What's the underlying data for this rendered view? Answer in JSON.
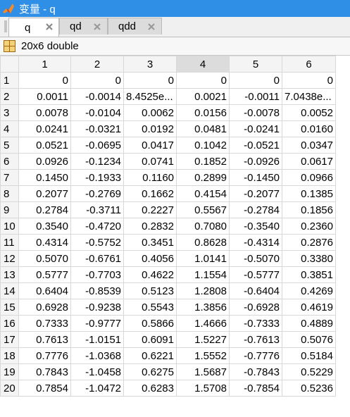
{
  "window": {
    "title": "变量 - q"
  },
  "tabs": [
    {
      "label": "q",
      "active": true
    },
    {
      "label": "qd",
      "active": false
    },
    {
      "label": "qdd",
      "active": false
    }
  ],
  "info": {
    "size_text": "20x6 double"
  },
  "table": {
    "columns": [
      "1",
      "2",
      "3",
      "4",
      "5",
      "6"
    ],
    "selected_column": "4",
    "rows": [
      {
        "label": "1",
        "cells": [
          "0",
          "0",
          "0",
          "0",
          "0",
          "0"
        ]
      },
      {
        "label": "2",
        "cells": [
          "0.0011",
          "-0.0014",
          "8.4525e...",
          "0.0021",
          "-0.0011",
          "7.0438e..."
        ]
      },
      {
        "label": "3",
        "cells": [
          "0.0078",
          "-0.0104",
          "0.0062",
          "0.0156",
          "-0.0078",
          "0.0052"
        ]
      },
      {
        "label": "4",
        "cells": [
          "0.0241",
          "-0.0321",
          "0.0192",
          "0.0481",
          "-0.0241",
          "0.0160"
        ]
      },
      {
        "label": "5",
        "cells": [
          "0.0521",
          "-0.0695",
          "0.0417",
          "0.1042",
          "-0.0521",
          "0.0347"
        ]
      },
      {
        "label": "6",
        "cells": [
          "0.0926",
          "-0.1234",
          "0.0741",
          "0.1852",
          "-0.0926",
          "0.0617"
        ]
      },
      {
        "label": "7",
        "cells": [
          "0.1450",
          "-0.1933",
          "0.1160",
          "0.2899",
          "-0.1450",
          "0.0966"
        ]
      },
      {
        "label": "8",
        "cells": [
          "0.2077",
          "-0.2769",
          "0.1662",
          "0.4154",
          "-0.2077",
          "0.1385"
        ]
      },
      {
        "label": "9",
        "cells": [
          "0.2784",
          "-0.3711",
          "0.2227",
          "0.5567",
          "-0.2784",
          "0.1856"
        ]
      },
      {
        "label": "10",
        "cells": [
          "0.3540",
          "-0.4720",
          "0.2832",
          "0.7080",
          "-0.3540",
          "0.2360"
        ]
      },
      {
        "label": "11",
        "cells": [
          "0.4314",
          "-0.5752",
          "0.3451",
          "0.8628",
          "-0.4314",
          "0.2876"
        ]
      },
      {
        "label": "12",
        "cells": [
          "0.5070",
          "-0.6761",
          "0.4056",
          "1.0141",
          "-0.5070",
          "0.3380"
        ]
      },
      {
        "label": "13",
        "cells": [
          "0.5777",
          "-0.7703",
          "0.4622",
          "1.1554",
          "-0.5777",
          "0.3851"
        ]
      },
      {
        "label": "14",
        "cells": [
          "0.6404",
          "-0.8539",
          "0.5123",
          "1.2808",
          "-0.6404",
          "0.4269"
        ]
      },
      {
        "label": "15",
        "cells": [
          "0.6928",
          "-0.9238",
          "0.5543",
          "1.3856",
          "-0.6928",
          "0.4619"
        ]
      },
      {
        "label": "16",
        "cells": [
          "0.7333",
          "-0.9777",
          "0.5866",
          "1.4666",
          "-0.7333",
          "0.4889"
        ]
      },
      {
        "label": "17",
        "cells": [
          "0.7613",
          "-1.0151",
          "0.6091",
          "1.5227",
          "-0.7613",
          "0.5076"
        ]
      },
      {
        "label": "18",
        "cells": [
          "0.7776",
          "-1.0368",
          "0.6221",
          "1.5552",
          "-0.7776",
          "0.5184"
        ]
      },
      {
        "label": "19",
        "cells": [
          "0.7843",
          "-1.0458",
          "0.6275",
          "1.5687",
          "-0.7843",
          "0.5229"
        ]
      },
      {
        "label": "20",
        "cells": [
          "0.7854",
          "-1.0472",
          "0.6283",
          "1.5708",
          "-0.7854",
          "0.5236"
        ]
      }
    ]
  },
  "colors": {
    "titlebar": "#2f8ee5",
    "selected_header": "#dcdcdc",
    "grid_line": "#d8d8d8"
  }
}
